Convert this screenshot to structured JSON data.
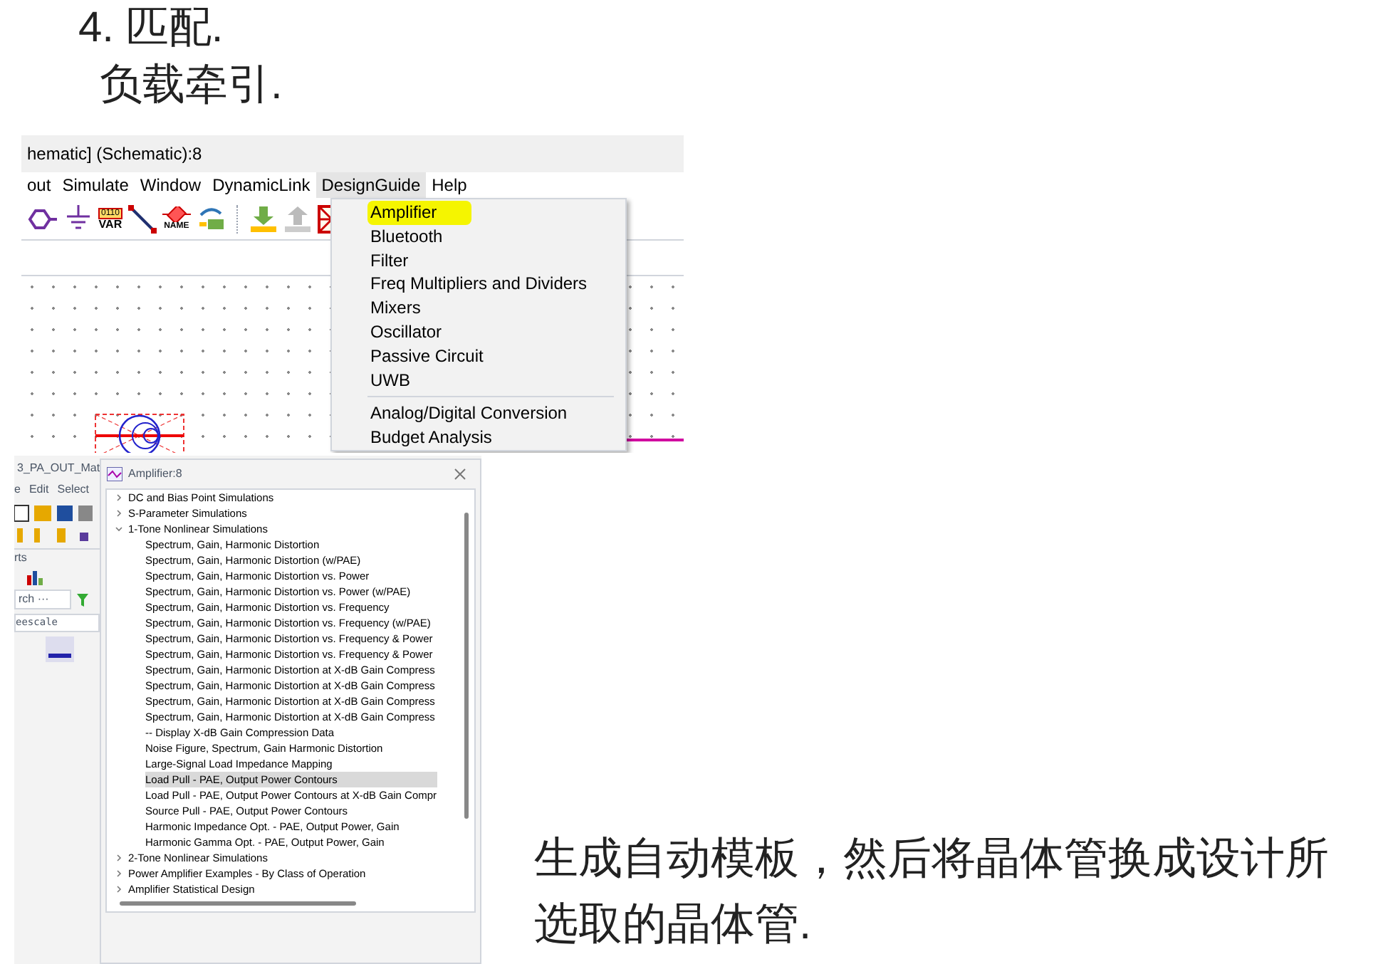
{
  "notes_top": [
    "4. 匹配.",
    "负载牵引."
  ],
  "schematic": {
    "title": "hematic] (Schematic):8",
    "menu": [
      {
        "label": "out",
        "selected": false
      },
      {
        "label": "Simulate",
        "selected": false
      },
      {
        "label": "Window",
        "selected": false
      },
      {
        "label": "DynamicLink",
        "selected": false
      },
      {
        "label": "DesignGuide",
        "selected": true
      },
      {
        "label": "Help",
        "selected": false
      }
    ],
    "toolbar": [
      {
        "kind": "port"
      },
      {
        "kind": "ground"
      },
      {
        "kind": "var",
        "texts": [
          "0110",
          "VAR"
        ]
      },
      {
        "kind": "wire"
      },
      {
        "kind": "name",
        "texts": [
          "NAME"
        ]
      },
      {
        "kind": "swap"
      },
      {
        "kind": "separator"
      },
      {
        "kind": "down"
      },
      {
        "kind": "up"
      },
      {
        "kind": "cross"
      }
    ],
    "dropdown": [
      {
        "label": "Amplifier",
        "highlighted": true,
        "separator_before": false
      },
      {
        "label": "Bluetooth",
        "highlighted": false,
        "separator_before": false
      },
      {
        "label": "Filter",
        "highlighted": false,
        "separator_before": false
      },
      {
        "label": "Freq Multipliers and Dividers",
        "highlighted": false,
        "separator_before": false
      },
      {
        "label": "Mixers",
        "highlighted": false,
        "separator_before": false
      },
      {
        "label": "Oscillator",
        "highlighted": false,
        "separator_before": false
      },
      {
        "label": "Passive Circuit",
        "highlighted": false,
        "separator_before": false
      },
      {
        "label": "UWB",
        "highlighted": false,
        "separator_before": false
      },
      {
        "label": "Analog/Digital Conversion",
        "highlighted": false,
        "separator_before": true
      },
      {
        "label": "Budget Analysis",
        "highlighted": false,
        "separator_before": false
      }
    ]
  },
  "main_window": {
    "title": "3_PA_OUT_Mat",
    "menu": [
      "e",
      "Edit",
      "Select"
    ],
    "panel_title": "rts",
    "search": "rch ···",
    "library": "eescale"
  },
  "dialog": {
    "title": "Amplifier:8",
    "tree": [
      {
        "label": "DC and Bias Point Simulations",
        "expanded": false
      },
      {
        "label": "S-Parameter Simulations",
        "expanded": false
      },
      {
        "label": "1-Tone Nonlinear Simulations",
        "expanded": true,
        "children": [
          {
            "label": "Spectrum, Gain, Harmonic Distortion",
            "selected": false
          },
          {
            "label": "Spectrum, Gain, Harmonic Distortion (w/PAE)",
            "selected": false
          },
          {
            "label": "Spectrum, Gain, Harmonic Distortion vs. Power",
            "selected": false
          },
          {
            "label": "Spectrum, Gain, Harmonic Distortion vs. Power (w/PAE)",
            "selected": false
          },
          {
            "label": "Spectrum, Gain, Harmonic Distortion vs. Frequency",
            "selected": false
          },
          {
            "label": "Spectrum, Gain, Harmonic Distortion vs. Frequency (w/PAE)",
            "selected": false
          },
          {
            "label": "Spectrum, Gain, Harmonic Distortion vs. Frequency & Power",
            "selected": false
          },
          {
            "label": "Spectrum, Gain, Harmonic Distortion vs. Frequency & Power",
            "selected": false
          },
          {
            "label": "Spectrum, Gain, Harmonic Distortion at X-dB Gain Compress",
            "selected": false
          },
          {
            "label": "Spectrum, Gain, Harmonic Distortion at X-dB Gain Compress",
            "selected": false
          },
          {
            "label": "Spectrum, Gain, Harmonic Distortion at X-dB Gain Compress",
            "selected": false
          },
          {
            "label": "Spectrum, Gain, Harmonic Distortion at X-dB Gain Compress",
            "selected": false
          },
          {
            "label": "-- Display X-dB Gain Compression Data",
            "selected": false
          },
          {
            "label": "Noise Figure, Spectrum, Gain Harmonic Distortion",
            "selected": false
          },
          {
            "label": "Large-Signal Load Impedance Mapping",
            "selected": false
          },
          {
            "label": "Load Pull - PAE, Output Power Contours",
            "selected": true
          },
          {
            "label": "Load Pull - PAE, Output Power Contours at X-dB Gain Compr",
            "selected": false
          },
          {
            "label": "Source Pull - PAE, Output Power Contours",
            "selected": false
          },
          {
            "label": "Harmonic Impedance Opt. - PAE, Output Power, Gain",
            "selected": false
          },
          {
            "label": "Harmonic Gamma Opt. - PAE, Output Power, Gain",
            "selected": false
          }
        ]
      },
      {
        "label": "2-Tone Nonlinear Simulations",
        "expanded": false
      },
      {
        "label": "Power Amplifier Examples - By Class of Operation",
        "expanded": false
      },
      {
        "label": "Amplifier Statistical Design",
        "expanded": false
      }
    ]
  },
  "notes_bottom": [
    "生成自动模板，然后将晶体管换成设计所",
    "选取的晶体管."
  ]
}
